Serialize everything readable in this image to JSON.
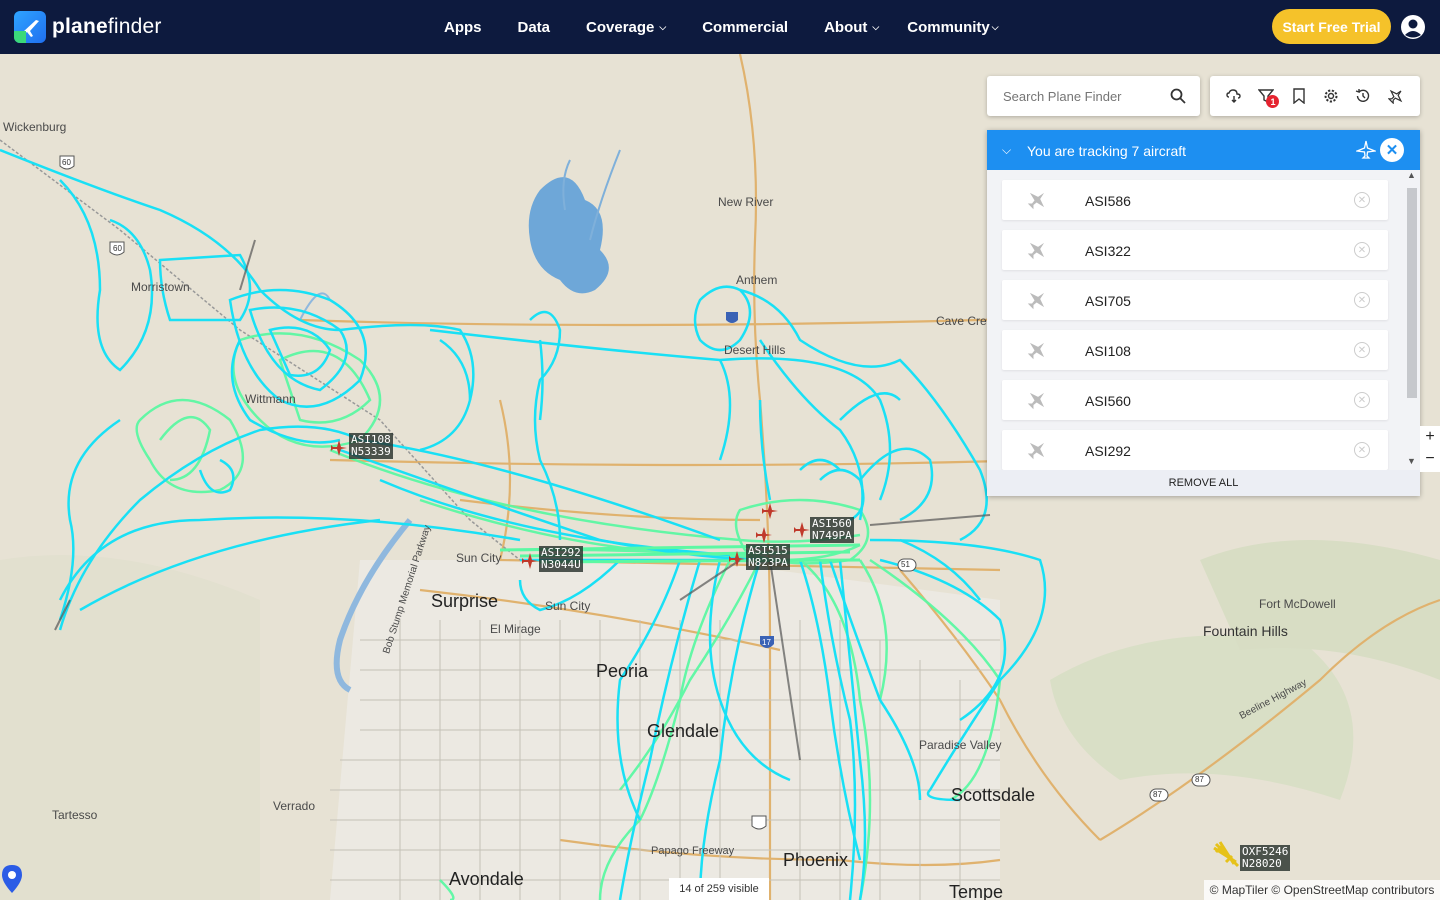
{
  "brand": {
    "name_bold": "plane",
    "name_rest": "finder"
  },
  "nav": {
    "apps": "Apps",
    "data": "Data",
    "coverage": "Coverage",
    "commercial": "Commercial",
    "about": "About",
    "community": "Community"
  },
  "header": {
    "trial_button": "Start Free Trial"
  },
  "search": {
    "placeholder": "Search Plane Finder"
  },
  "toolbar": {
    "filter_badge": "1"
  },
  "tracking": {
    "title": "You are tracking 7 aircraft",
    "items": [
      "ASI586",
      "ASI322",
      "ASI705",
      "ASI108",
      "ASI560",
      "ASI292"
    ],
    "remove_all": "REMOVE ALL"
  },
  "map": {
    "places": {
      "wickenburg": "Wickenburg",
      "morristown": "Morristown",
      "new_river": "New River",
      "anthem": "Anthem",
      "cave_creek": "Cave Creek",
      "desert_hills": "Desert Hills",
      "sun_city_west": "Sun City",
      "surprise": "Surprise",
      "sun_city": "Sun City",
      "el_mirage": "El Mirage",
      "peoria": "Peoria",
      "glendale": "Glendale",
      "paradise_valley": "Paradise Valley",
      "scottsdale": "Scottsdale",
      "fort_mcdowell": "Fort McDowell",
      "fountain_hills": "Fountain Hills",
      "tartesso": "Tartesso",
      "verrado": "Verrado",
      "papago": "Papago Freeway",
      "phoenix": "Phoenix",
      "avondale": "Avondale",
      "tempe": "Tempe",
      "beeline": "Beeline Highway",
      "bob_stump": "Bob Stump Memorial Parkway",
      "wittmann": "Wittmann"
    },
    "highways": {
      "h60a": "60",
      "h60b": "60",
      "h17": "17",
      "h51": "51",
      "h87a": "87",
      "h87b": "87"
    },
    "aircraft": [
      {
        "callsign": "ASI108",
        "reg": "N53339"
      },
      {
        "callsign": "ASI292",
        "reg": "N3044U"
      },
      {
        "callsign": "ASI515",
        "reg": "N823PA"
      },
      {
        "callsign": "ASI560",
        "reg": "N749PA"
      },
      {
        "callsign": "OXF5246",
        "reg": "N28020"
      }
    ],
    "visible_count": "14 of 259 visible",
    "attribution": "© MapTiler © OpenStreetMap contributors",
    "zoom_in": "+",
    "zoom_out": "−"
  },
  "colors": {
    "nav_bg": "#0d1a3e",
    "accent": "#1d8ff1",
    "trial": "#f5c22a",
    "track_cyan": "#19e0f5",
    "track_green": "#5cf8a3",
    "badge": "#e5232f"
  }
}
